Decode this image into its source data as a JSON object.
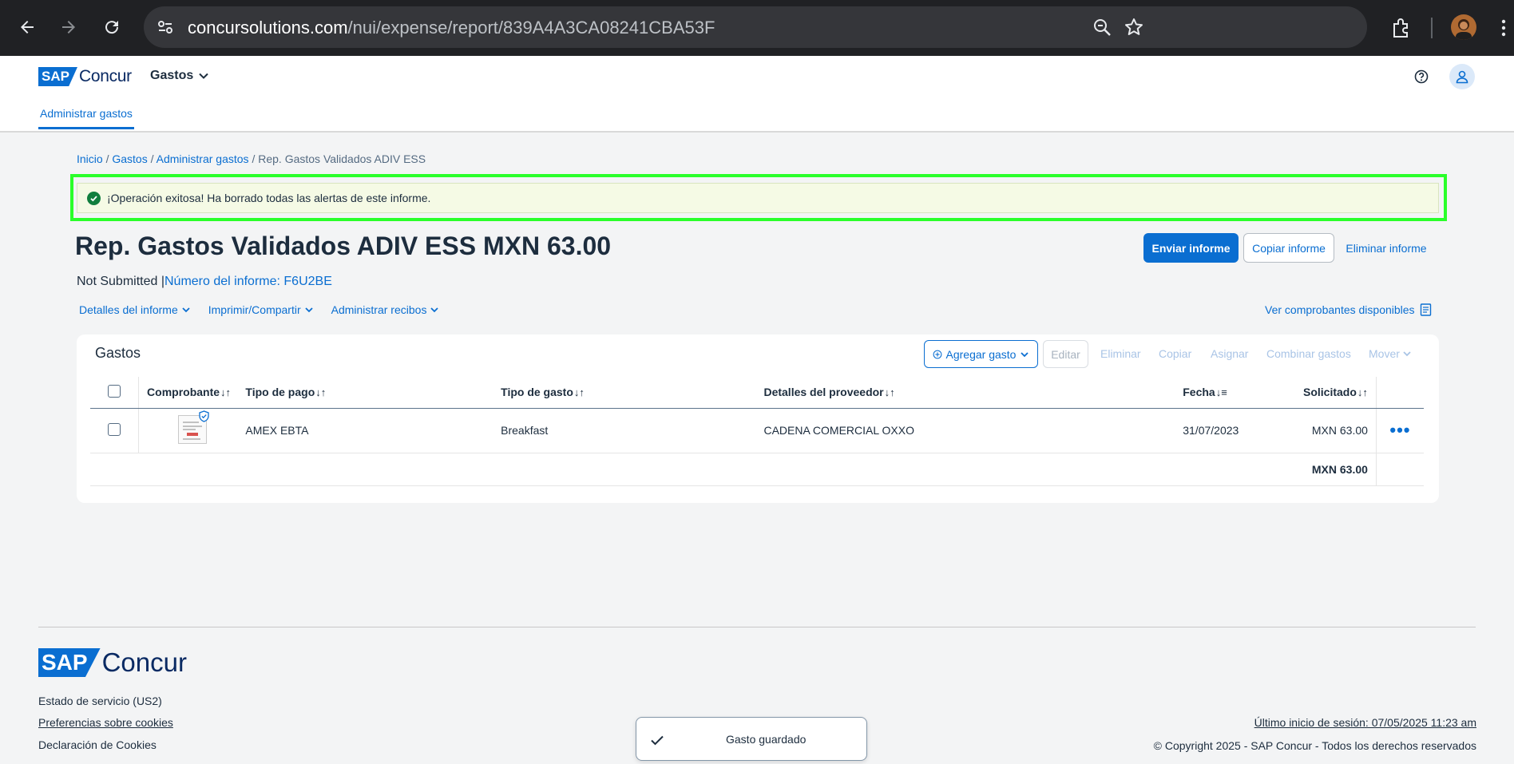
{
  "browser": {
    "url_host": "concursolutions.com",
    "url_path": "/nui/expense/report/839A4A3CA08241CBA53F"
  },
  "header": {
    "logo_sap": "SAP",
    "logo_concur": "Concur",
    "menu_label": "Gastos",
    "tab_label": "Administrar gastos"
  },
  "breadcrumb": {
    "items": [
      "Inicio",
      "Gastos",
      "Administrar gastos"
    ],
    "current": "Rep. Gastos Validados ADIV ESS",
    "sep": " / "
  },
  "banner": {
    "message": "¡Operación exitosa! Ha borrado todas las alertas de este informe."
  },
  "report": {
    "title": "Rep. Gastos Validados ADIV ESS MXN 63.00",
    "status": "Not Submitted",
    "number_label": "Número del informe: F6U2BE",
    "actions": {
      "submit": "Enviar informe",
      "copy": "Copiar informe",
      "delete": "Eliminar informe"
    },
    "menus": [
      "Detalles del informe",
      "Imprimir/Compartir",
      "Administrar recibos"
    ],
    "receipts_link": "Ver comprobantes disponibles"
  },
  "expenses": {
    "title": "Gastos",
    "toolbar": {
      "add": "Agregar gasto",
      "edit": "Editar",
      "delete": "Eliminar",
      "copy": "Copiar",
      "assign": "Asignar",
      "combine": "Combinar gastos",
      "move": "Mover"
    },
    "columns": {
      "receipt": "Comprobante",
      "payment_type": "Tipo de pago",
      "expense_type": "Tipo de gasto",
      "vendor": "Detalles del proveedor",
      "date": "Fecha",
      "requested": "Solicitado"
    },
    "rows": [
      {
        "payment_type": "AMEX EBTA",
        "expense_type": "Breakfast",
        "vendor": "CADENA COMERCIAL OXXO",
        "date": "31/07/2023",
        "requested": "MXN 63.00"
      }
    ],
    "total": "MXN 63.00"
  },
  "footer": {
    "logo_sap": "SAP",
    "logo_concur": "Concur",
    "service_status": "Estado de servicio (US2)",
    "cookie_prefs": "Preferencias sobre cookies",
    "cookie_statement": "Declaración de Cookies",
    "last_login": "Último inicio de sesión: 07/05/2025 11:23 am",
    "copyright": "© Copyright 2025 - SAP Concur - Todos los derechos reservados"
  },
  "toast": {
    "message": "Gasto guardado"
  },
  "colors": {
    "accent": "#0a6ed1",
    "success": "#107e3e",
    "highlight": "#2aff2a"
  }
}
